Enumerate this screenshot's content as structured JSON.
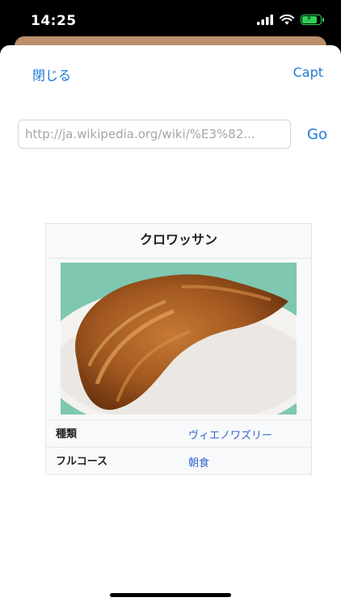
{
  "status_bar": {
    "time": "14:25"
  },
  "nav": {
    "close_label": "閉じる",
    "capture_label": "Capt"
  },
  "url_bar": {
    "value": "http://ja.wikipedia.org/wiki/%E3%82...",
    "go_label": "Go"
  },
  "infobox": {
    "title": "クロワッサン",
    "rows": [
      {
        "label": "種類",
        "value": "ヴィエノワズリー"
      },
      {
        "label": "フルコース",
        "value": "朝食"
      }
    ]
  },
  "colors": {
    "accent": "#1e78d7",
    "link": "#3366cc",
    "battery": "#30d158"
  }
}
